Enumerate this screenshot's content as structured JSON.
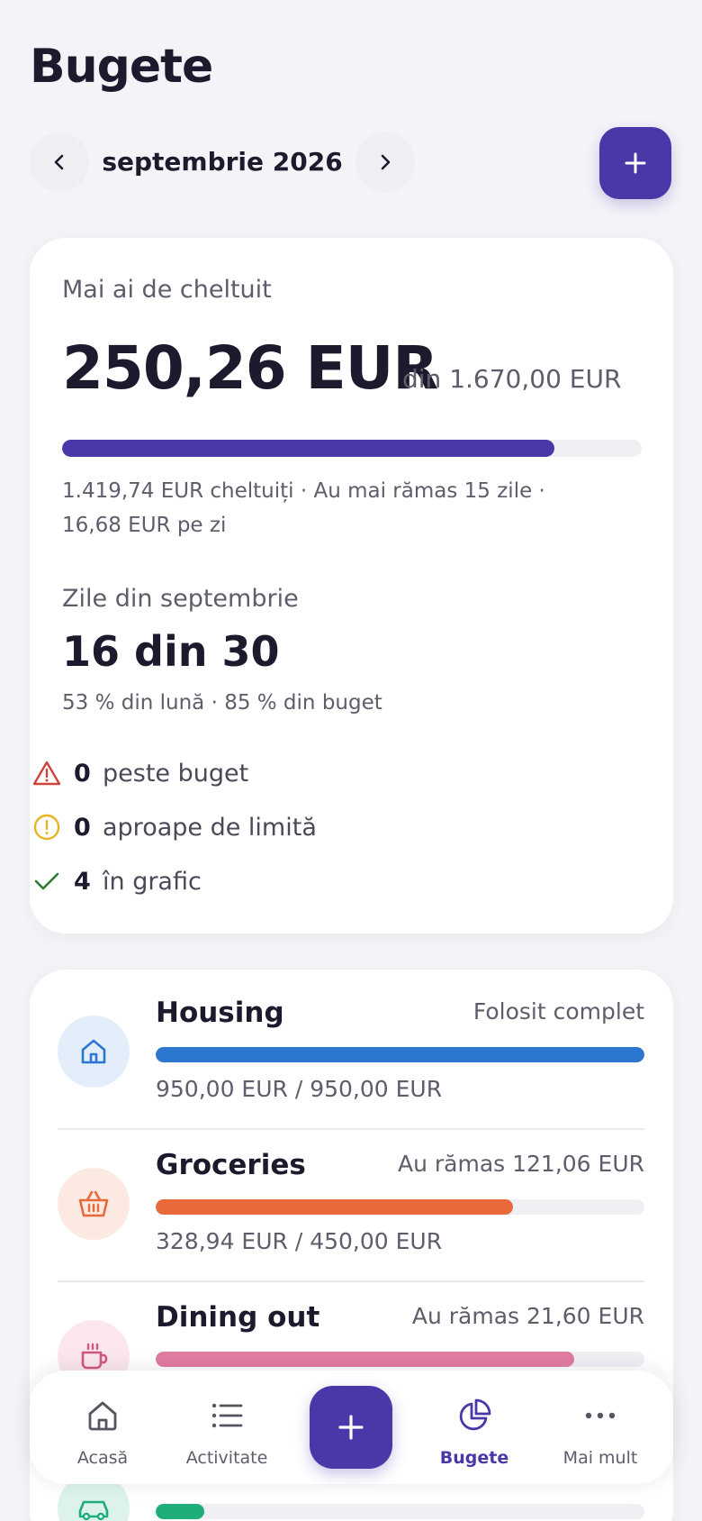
{
  "header": {
    "title": "Bugete"
  },
  "month_nav": {
    "label": "septembrie 2026"
  },
  "summary": {
    "label": "Mai ai de cheltuit",
    "amount": "250,26 EUR",
    "of_total": "din 1.670,00 EUR",
    "progress_fraction": 0.85,
    "line1": "1.419,74 EUR cheltuiți · Au mai rămas 15 zile ·",
    "line2": "16,68 EUR pe zi",
    "days_label": "Zile din septembrie",
    "days_value": "16 din 30",
    "percent_line": "53 % din lună · 85 % din buget",
    "stats": [
      {
        "count": "0",
        "label": "peste buget",
        "icon": "warning-triangle-icon",
        "color": "#D0433A"
      },
      {
        "count": "0",
        "label": "aproape de limită",
        "icon": "alert-circle-icon",
        "color": "#E6B422"
      },
      {
        "count": "4",
        "label": "în grafic",
        "icon": "check-icon",
        "color": "#2E7D32"
      }
    ]
  },
  "budgets": [
    {
      "name": "Housing",
      "status": "Folosit complet",
      "amount": "950,00 EUR / 950,00 EUR",
      "progress_fraction": 1.0,
      "color": "#2E77D0",
      "icon_bg": "#E4EEFB",
      "icon": "home-icon"
    },
    {
      "name": "Groceries",
      "status": "Au rămas 121,06 EUR",
      "amount": "328,94 EUR / 450,00 EUR",
      "progress_fraction": 0.731,
      "color": "#E8693A",
      "icon_bg": "#FCE9E2",
      "icon": "basket-icon"
    },
    {
      "name": "Dining out",
      "status": "Au rămas 21,60 EUR",
      "amount": "",
      "progress_fraction": 0.856,
      "color": "#E07BA0",
      "icon_bg": "#FBE6EE",
      "icon": "cup-icon"
    },
    {
      "name": "",
      "status": "",
      "amount": "",
      "progress_fraction": 0.1,
      "color": "#1FAE7A",
      "icon_bg": "#DDF3EA",
      "icon": "car-icon"
    }
  ],
  "tabbar": {
    "items": [
      {
        "label": "Acasă",
        "icon": "home-icon"
      },
      {
        "label": "Activitate",
        "icon": "list-icon"
      },
      {
        "label": "Bugete",
        "icon": "pie-chart-icon",
        "active": true
      },
      {
        "label": "Mai mult",
        "icon": "more-dots-icon"
      }
    ]
  },
  "colors": {
    "accent": "#4B38A8",
    "background": "#F4F4F8"
  }
}
